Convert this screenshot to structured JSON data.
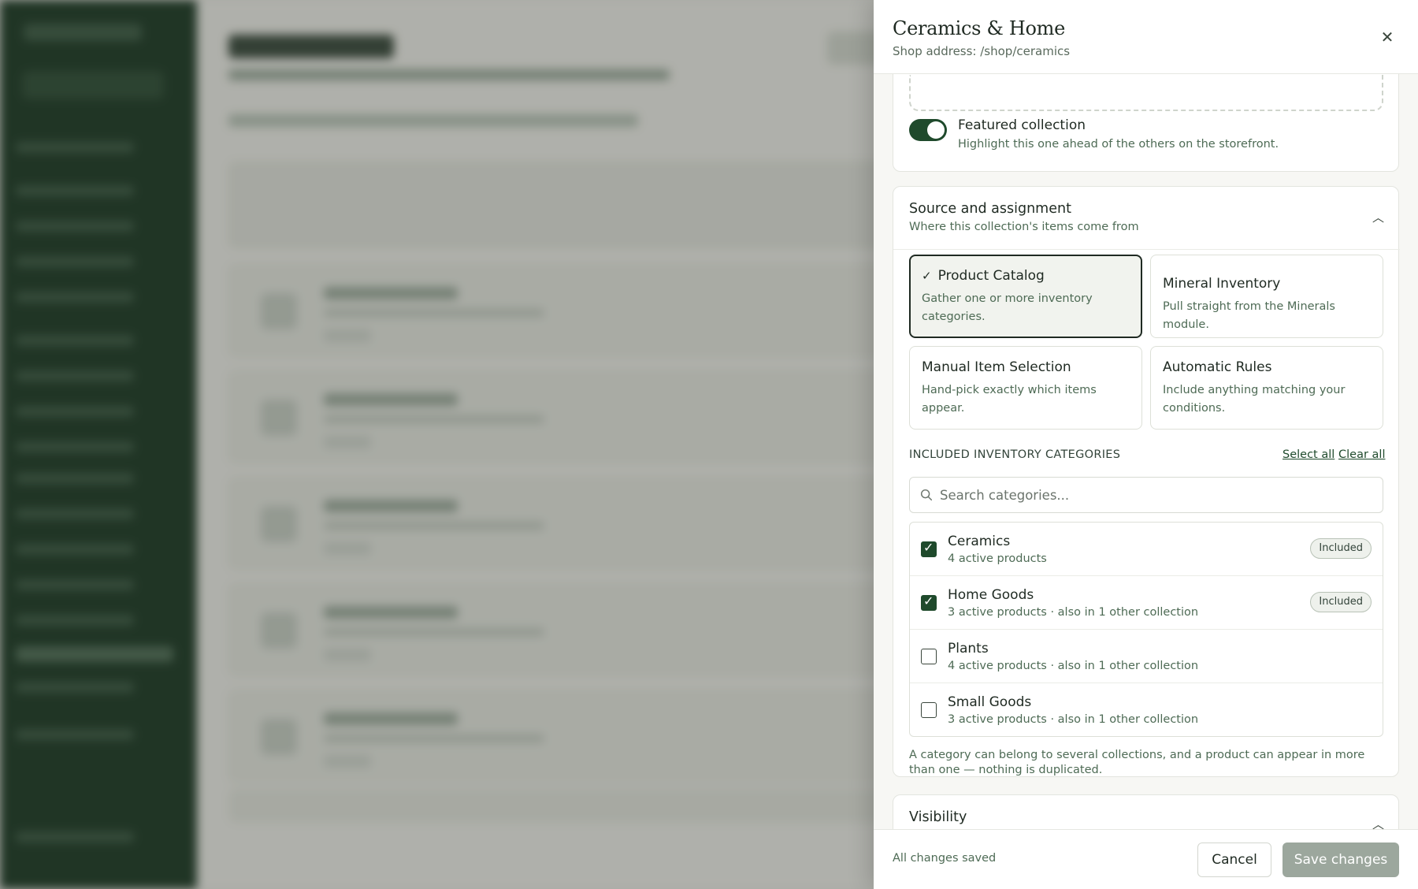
{
  "drawer": {
    "title": "Ceramics & Home",
    "subtitle": "Shop address: /shop/ceramics",
    "close_icon": "close-icon"
  },
  "featured": {
    "label": "Featured collection",
    "description": "Highlight this one ahead of the others on the storefront.",
    "enabled": true
  },
  "source_section": {
    "title": "Source and assignment",
    "subtitle": "Where this collection's items come from",
    "options": [
      {
        "title": "Product Catalog",
        "description": "Gather one or more inventory categories.",
        "selected": true
      },
      {
        "title": "Mineral Inventory",
        "description": "Pull straight from the Minerals module.",
        "selected": false
      },
      {
        "title": "Manual Item Selection",
        "description": "Hand-pick exactly which items appear.",
        "selected": false
      },
      {
        "title": "Automatic Rules",
        "description": "Include anything matching your conditions.",
        "selected": false
      }
    ],
    "included_label": "INCLUDED INVENTORY CATEGORIES",
    "select_all": "Select all",
    "clear_all": "Clear all",
    "search_placeholder": "Search categories...",
    "categories": [
      {
        "name": "Ceramics",
        "meta": "4 active products",
        "checked": true,
        "badge": "Included"
      },
      {
        "name": "Home Goods",
        "meta": "3 active products · also in 1 other collection",
        "checked": true,
        "badge": "Included"
      },
      {
        "name": "Plants",
        "meta": "4 active products · also in 1 other collection",
        "checked": false,
        "badge": ""
      },
      {
        "name": "Small Goods",
        "meta": "3 active products · also in 1 other collection",
        "checked": false,
        "badge": ""
      }
    ],
    "note": "A category can belong to several collections, and a product can appear in more than one — nothing is duplicated."
  },
  "visibility_section": {
    "title": "Visibility"
  },
  "footer": {
    "status": "All changes saved",
    "cancel": "Cancel",
    "save": "Save changes"
  },
  "colors": {
    "accent": "#1f4a2c",
    "save_disabled": "#9ca79d",
    "muted_text": "#4e6b55"
  }
}
